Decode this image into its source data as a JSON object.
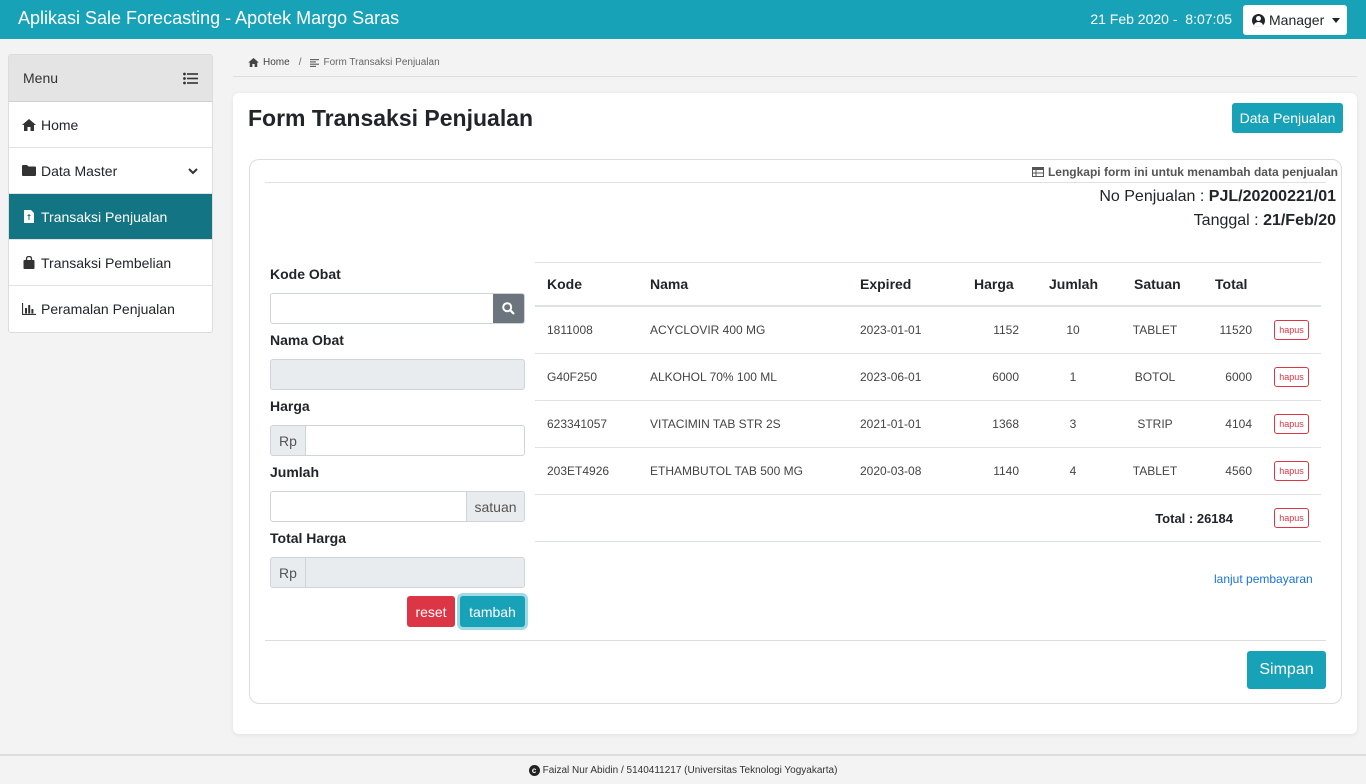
{
  "app": {
    "title": "Aplikasi Sale Forecasting - Apotek Margo Saras",
    "date": "21 Feb 2020",
    "time": "8:07:05",
    "user_label": "Manager",
    "primary_color": "#17a2b8"
  },
  "sidebar": {
    "heading": "Menu",
    "items": [
      {
        "label": "Home",
        "icon": "home-icon"
      },
      {
        "label": "Data Master",
        "icon": "folder-icon"
      },
      {
        "label": "Transaksi Penjualan",
        "icon": "file-invoice-icon",
        "active": true
      },
      {
        "label": "Transaksi Pembelian",
        "icon": "shopping-bag-icon"
      },
      {
        "label": "Peramalan Penjualan",
        "icon": "chart-bar-icon"
      }
    ]
  },
  "breadcrumb": {
    "home": "Home",
    "current": "Form Transaksi Penjualan"
  },
  "page": {
    "title": "Form Transaksi Penjualan",
    "data_button": "Data Penjualan",
    "note": "Lengkapi form ini untuk menambah data penjualan",
    "no_label": "No Penjualan :",
    "no_value": "PJL/20200221/01",
    "tanggal_label": "Tanggal :",
    "tanggal_value": "21/Feb/20"
  },
  "form": {
    "kode_label": "Kode Obat",
    "nama_label": "Nama Obat",
    "harga_label": "Harga",
    "harga_prefix": "Rp",
    "jumlah_label": "Jumlah",
    "jumlah_suffix": "satuan",
    "total_label": "Total Harga",
    "total_prefix": "Rp",
    "reset": "reset",
    "tambah": "tambah"
  },
  "table": {
    "headers": [
      "Kode",
      "Nama",
      "Expired",
      "Harga",
      "Jumlah",
      "Satuan",
      "Total"
    ],
    "rows": [
      {
        "kode": "1811008",
        "nama": "ACYCLOVIR 400 MG",
        "expired": "2023-01-01",
        "harga": "1152",
        "jumlah": "10",
        "satuan": "TABLET",
        "total": "11520",
        "hapus": "hapus"
      },
      {
        "kode": "G40F250",
        "nama": "ALKOHOL 70% 100 ML",
        "expired": "2023-06-01",
        "harga": "6000",
        "jumlah": "1",
        "satuan": "BOTOL",
        "total": "6000",
        "hapus": "hapus"
      },
      {
        "kode": "623341057",
        "nama": "VITACIMIN TAB STR 2S",
        "expired": "2021-01-01",
        "harga": "1368",
        "jumlah": "3",
        "satuan": "STRIP",
        "total": "4104",
        "hapus": "hapus"
      },
      {
        "kode": "203ET4926",
        "nama": "ETHAMBUTOL TAB 500 MG",
        "expired": "2020-03-08",
        "harga": "1140",
        "jumlah": "4",
        "satuan": "TABLET",
        "total": "4560",
        "hapus": "hapus"
      }
    ],
    "total_text": "Total : 26184",
    "total_hapus": "hapus",
    "lanjut": "lanjut pembayaran"
  },
  "actions": {
    "simpan": "Simpan"
  },
  "footer": {
    "text": "Faizal Nur Abidin / 5140411217 (Universitas Teknologi Yogyakarta)"
  }
}
